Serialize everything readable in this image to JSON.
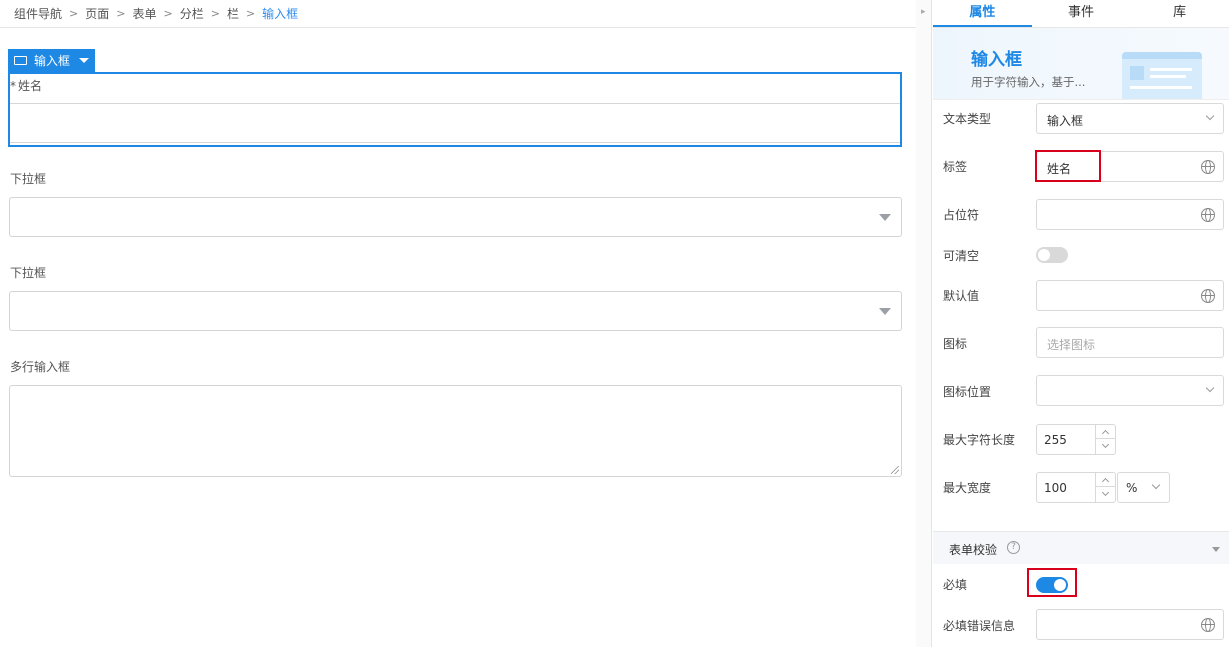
{
  "breadcrumb": {
    "items": [
      "组件导航",
      "页面",
      "表单",
      "分栏",
      "栏",
      "输入框"
    ]
  },
  "canvas": {
    "selected_tag": "输入框",
    "name_field": {
      "required_mark": "*",
      "label": "姓名"
    },
    "dropdown1": {
      "label": "下拉框"
    },
    "dropdown2": {
      "label": "下拉框"
    },
    "textarea": {
      "label": "多行输入框"
    }
  },
  "panel": {
    "tabs": [
      "属性",
      "事件",
      "库"
    ],
    "active_tab": "属性",
    "hero": {
      "title": "输入框",
      "description": "用于字符输入，基于..."
    },
    "props": {
      "text_type": {
        "label": "文本类型",
        "value": "输入框"
      },
      "label": {
        "label": "标签",
        "value": "姓名"
      },
      "placeholder": {
        "label": "占位符",
        "value": ""
      },
      "clearable": {
        "label": "可清空",
        "on": false
      },
      "default_value": {
        "label": "默认值",
        "value": ""
      },
      "icon": {
        "label": "图标",
        "placeholder": "选择图标"
      },
      "icon_position": {
        "label": "图标位置",
        "value": ""
      },
      "max_length": {
        "label": "最大字符长度",
        "value": "255"
      },
      "max_width": {
        "label": "最大宽度",
        "value": "100",
        "unit": "%"
      }
    },
    "validation": {
      "title": "表单校验",
      "help": "?",
      "required": {
        "label": "必填",
        "on": true
      },
      "required_error": {
        "label": "必填错误信息",
        "value": ""
      }
    }
  },
  "colors": {
    "accent": "#1e88e5",
    "highlight": "#d9001b"
  },
  "icons": [
    "collapse-arrow-icon",
    "input-component-icon",
    "caret-down-icon",
    "globe-icon",
    "help-icon",
    "chevron-down-icon"
  ]
}
